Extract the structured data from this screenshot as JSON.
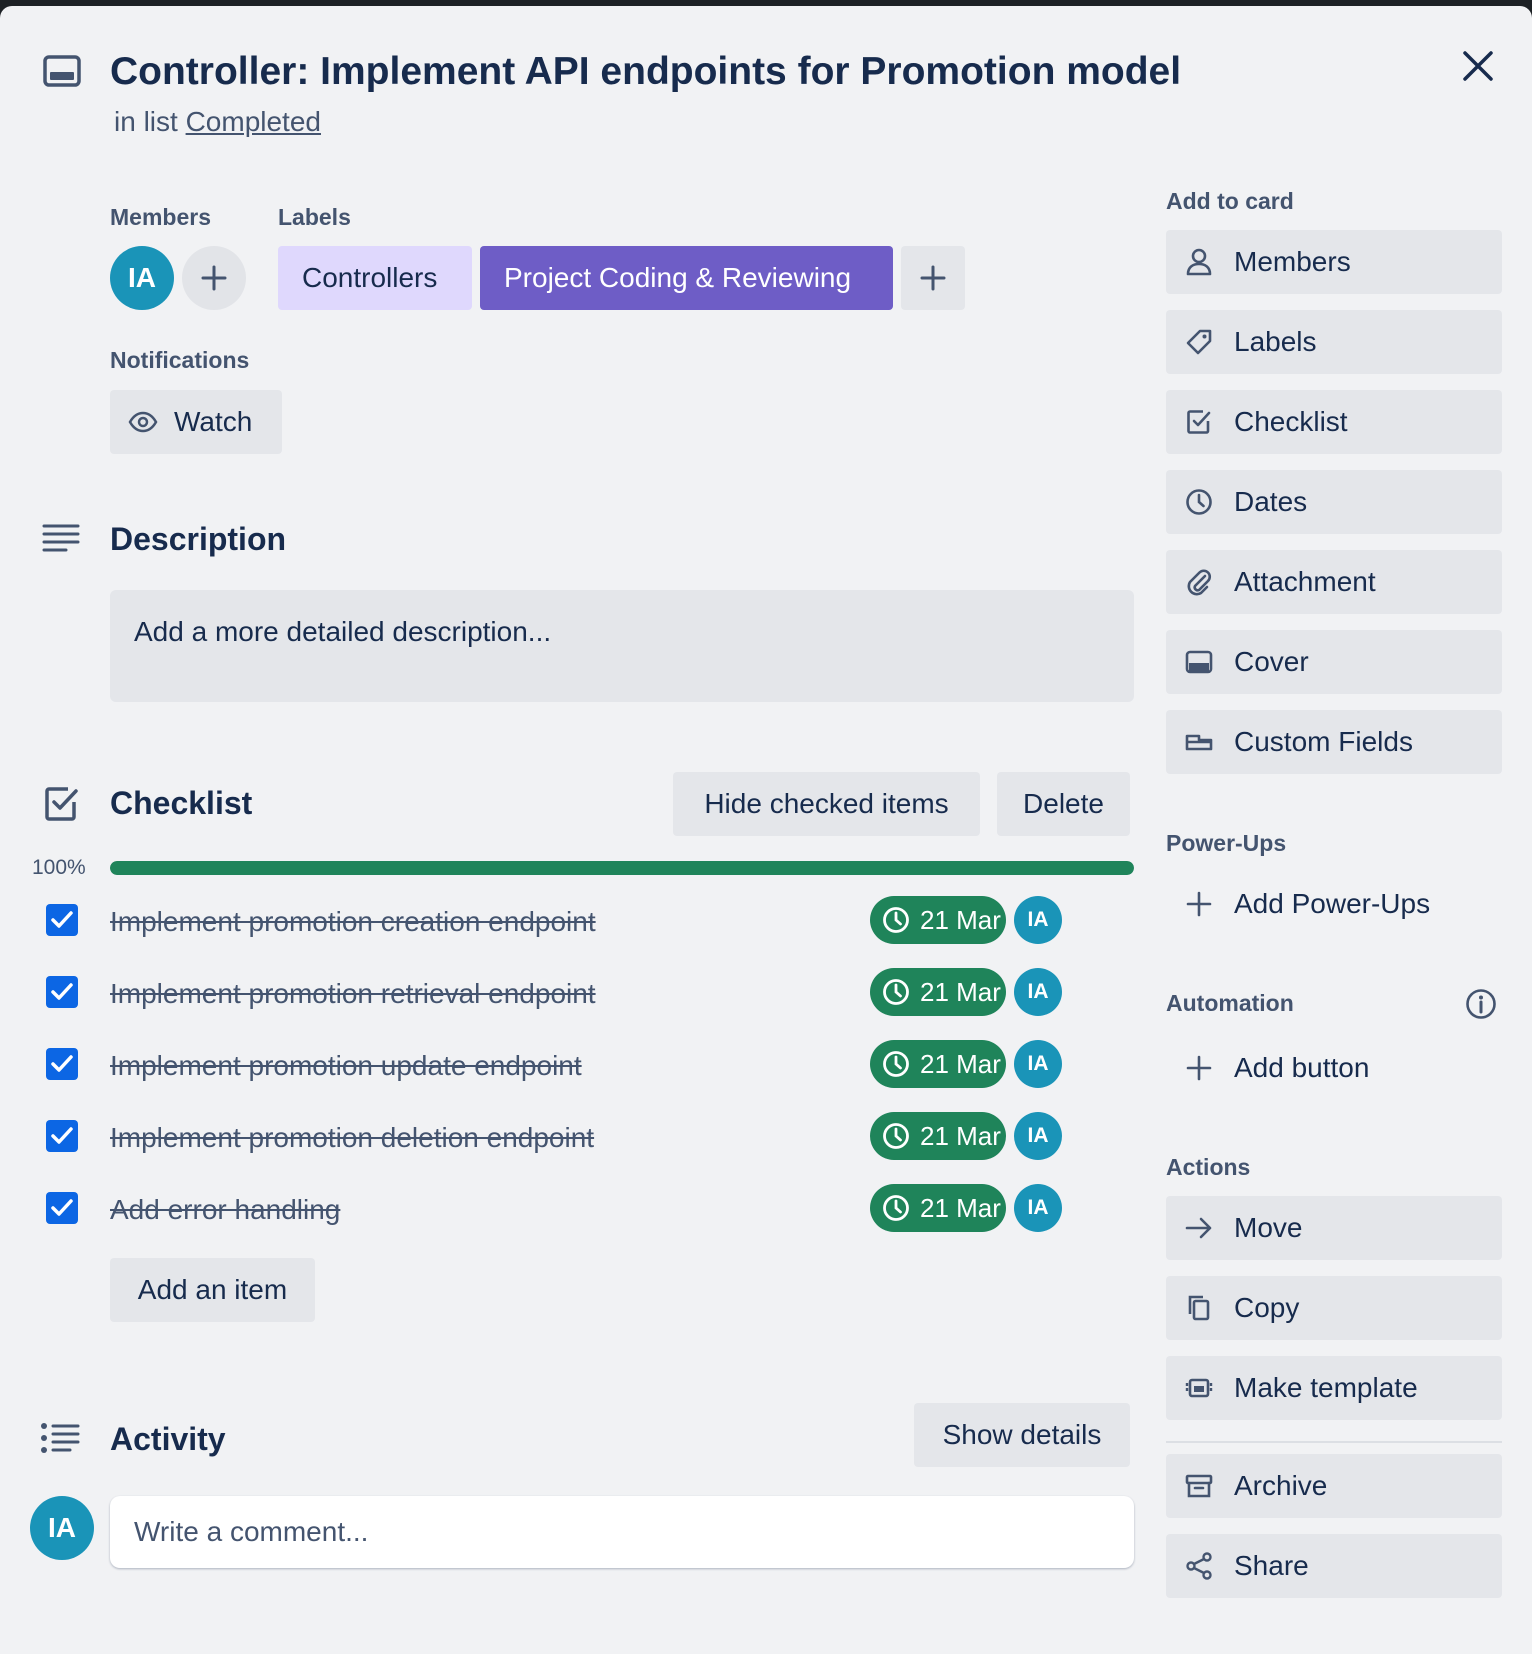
{
  "card": {
    "title": "Controller: Implement API endpoints for Promotion model",
    "in_list_prefix": "in list",
    "list_name": "Completed"
  },
  "members": {
    "heading": "Members",
    "avatar_initials": "IA"
  },
  "labels": {
    "heading": "Labels",
    "items": [
      {
        "text": "Controllers",
        "bg": "#dfd8fd",
        "fg": "#172b4d"
      },
      {
        "text": "Project Coding & Reviewing",
        "bg": "#6e5dc6",
        "fg": "#ffffff"
      }
    ]
  },
  "notifications": {
    "heading": "Notifications",
    "watch_label": "Watch"
  },
  "description": {
    "heading": "Description",
    "placeholder": "Add a more detailed description..."
  },
  "checklist": {
    "heading": "Checklist",
    "hide_checked_label": "Hide checked items",
    "delete_label": "Delete",
    "progress_text": "100%",
    "progress": 1.0,
    "items": [
      {
        "text": "Implement promotion creation endpoint",
        "checked": true,
        "due": "21 Mar",
        "assignee": "IA"
      },
      {
        "text": "Implement promotion retrieval endpoint",
        "checked": true,
        "due": "21 Mar",
        "assignee": "IA"
      },
      {
        "text": "Implement promotion update endpoint",
        "checked": true,
        "due": "21 Mar",
        "assignee": "IA"
      },
      {
        "text": "Implement promotion deletion endpoint",
        "checked": true,
        "due": "21 Mar",
        "assignee": "IA"
      },
      {
        "text": "Add error handling",
        "checked": true,
        "due": "21 Mar",
        "assignee": "IA"
      }
    ],
    "add_item_label": "Add an item"
  },
  "activity": {
    "heading": "Activity",
    "show_details_label": "Show details",
    "user_initials": "IA",
    "comment_placeholder": "Write a comment..."
  },
  "sidebar": {
    "add_to_card_heading": "Add to card",
    "add_to_card": [
      {
        "label": "Members",
        "icon": "person-icon"
      },
      {
        "label": "Labels",
        "icon": "tag-icon"
      },
      {
        "label": "Checklist",
        "icon": "checkbox-icon"
      },
      {
        "label": "Dates",
        "icon": "clock-icon"
      },
      {
        "label": "Attachment",
        "icon": "paperclip-icon"
      },
      {
        "label": "Cover",
        "icon": "cover-icon"
      },
      {
        "label": "Custom Fields",
        "icon": "custom-fields-icon"
      }
    ],
    "powerups_heading": "Power-Ups",
    "add_powerups_label": "Add Power-Ups",
    "automation_heading": "Automation",
    "add_button_label": "Add button",
    "actions_heading": "Actions",
    "actions": [
      {
        "label": "Move",
        "icon": "arrow-right-icon"
      },
      {
        "label": "Copy",
        "icon": "copy-icon"
      },
      {
        "label": "Make template",
        "icon": "template-icon"
      }
    ],
    "archive_label": "Archive",
    "share_label": "Share"
  },
  "colors": {
    "accent_blue": "#0c66e4",
    "success_green": "#1f845a",
    "avatar_teal": "#1a94b8",
    "modal_bg": "#f1f2f4"
  }
}
